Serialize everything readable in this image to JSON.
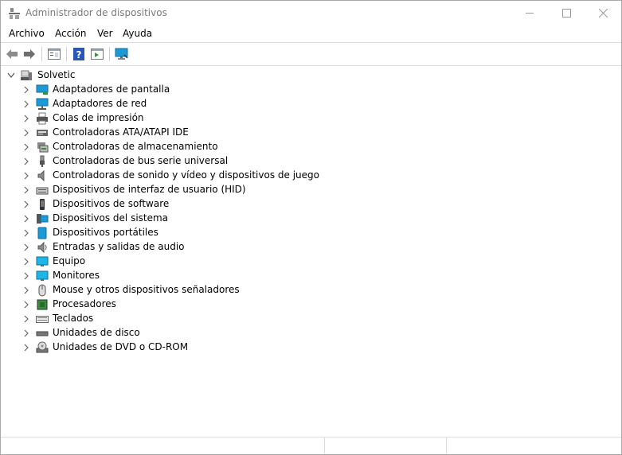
{
  "window": {
    "title": "Administrador de dispositivos"
  },
  "menu": {
    "items": [
      "Archivo",
      "Acción",
      "Ver",
      "Ayuda"
    ]
  },
  "toolbar": {
    "buttons": [
      "back-icon",
      "forward-icon",
      "properties-icon",
      "help-icon",
      "action-pane-icon",
      "monitor-scan-icon"
    ]
  },
  "tree": {
    "root": {
      "label": "Solvetic",
      "expanded": true,
      "icon": "computer-icon"
    },
    "categories": [
      {
        "label": "Adaptadores de pantalla",
        "icon": "display-adapter-icon"
      },
      {
        "label": "Adaptadores de red",
        "icon": "network-adapter-icon"
      },
      {
        "label": "Colas de impresión",
        "icon": "printer-icon"
      },
      {
        "label": "Controladoras ATA/ATAPI IDE",
        "icon": "ide-controller-icon"
      },
      {
        "label": "Controladoras de almacenamiento",
        "icon": "storage-controller-icon"
      },
      {
        "label": "Controladoras de bus serie universal",
        "icon": "usb-icon"
      },
      {
        "label": "Controladoras de sonido y vídeo y dispositivos de juego",
        "icon": "speaker-icon"
      },
      {
        "label": "Dispositivos de interfaz de usuario (HID)",
        "icon": "hid-icon"
      },
      {
        "label": "Dispositivos de software",
        "icon": "software-device-icon"
      },
      {
        "label": "Dispositivos del sistema",
        "icon": "system-device-icon"
      },
      {
        "label": "Dispositivos portátiles",
        "icon": "portable-device-icon"
      },
      {
        "label": "Entradas y salidas de audio",
        "icon": "audio-io-icon"
      },
      {
        "label": "Equipo",
        "icon": "computer-monitor-icon"
      },
      {
        "label": "Monitores",
        "icon": "monitor-icon"
      },
      {
        "label": "Mouse y otros dispositivos señaladores",
        "icon": "mouse-icon"
      },
      {
        "label": "Procesadores",
        "icon": "processor-icon"
      },
      {
        "label": "Teclados",
        "icon": "keyboard-icon"
      },
      {
        "label": "Unidades de disco",
        "icon": "disk-drive-icon"
      },
      {
        "label": "Unidades de DVD o CD-ROM",
        "icon": "dvd-icon"
      }
    ]
  },
  "colors": {
    "accent": "#1c9ad6",
    "title_text": "#7a7a7a"
  }
}
